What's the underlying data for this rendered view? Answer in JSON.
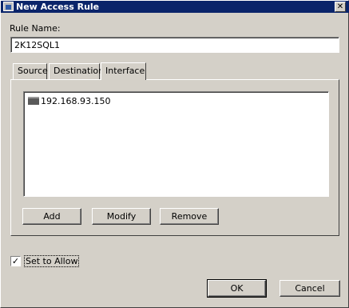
{
  "window": {
    "title": "New Access Rule",
    "close_glyph": "✕"
  },
  "form": {
    "rule_name_label": "Rule Name:",
    "rule_name_value": "2K12SQL1"
  },
  "tabs": [
    {
      "label": "Source",
      "active": false
    },
    {
      "label": "Destination",
      "active": false
    },
    {
      "label": "Interface",
      "active": true
    }
  ],
  "interface_list": {
    "items": [
      {
        "icon": "network-interface-icon",
        "text": "192.168.93.150"
      }
    ]
  },
  "list_buttons": {
    "add": "Add",
    "modify": "Modify",
    "remove": "Remove"
  },
  "allow": {
    "label": "Set to Allow",
    "checked": true,
    "check_glyph": "✓"
  },
  "footer": {
    "ok": "OK",
    "cancel": "Cancel"
  },
  "colors": {
    "titlebar": "#0a246a",
    "face": "#d4d0c8",
    "field": "#ffffff"
  }
}
